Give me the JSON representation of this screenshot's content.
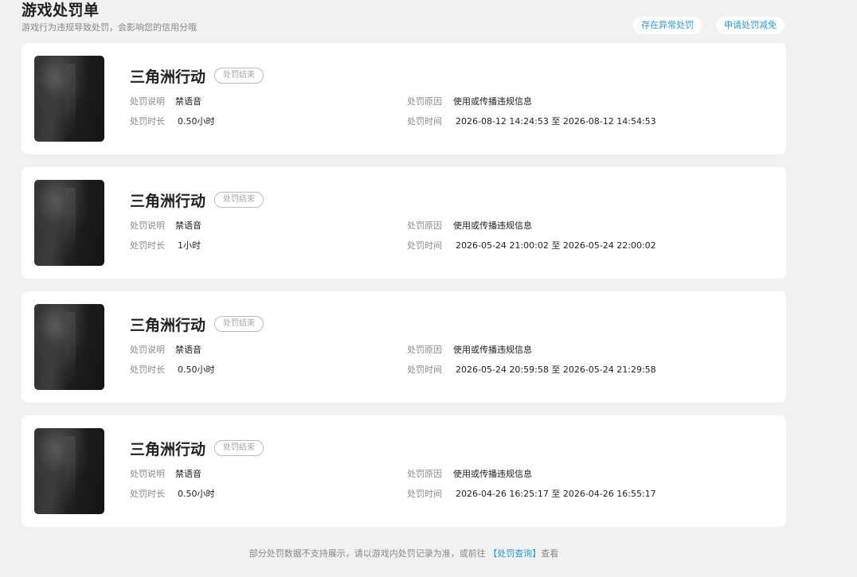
{
  "header": {
    "title": "游戏处罚单",
    "subtitle": "游戏行为违规导致处罚，会影响您的信用分哦",
    "abnormal_button": "存在异常处罚",
    "reduce_button": "申请处罚减免"
  },
  "labels": {
    "description": "处罚说明",
    "duration": "处罚时长",
    "reason": "处罚原因",
    "time": "处罚时间"
  },
  "records": [
    {
      "game": "三角洲行动",
      "status": "处罚结束",
      "description": "禁语音",
      "duration": "0.50小时",
      "reason": "使用或传播违规信息",
      "time": "2026-08-12 14:24:53 至 2026-08-12 14:54:53"
    },
    {
      "game": "三角洲行动",
      "status": "处罚结束",
      "description": "禁语音",
      "duration": "1小时",
      "reason": "使用或传播违规信息",
      "time": "2026-05-24 21:00:02 至 2026-05-24 22:00:02"
    },
    {
      "game": "三角洲行动",
      "status": "处罚结束",
      "description": "禁语音",
      "duration": "0.50小时",
      "reason": "使用或传播违规信息",
      "time": "2026-05-24 20:59:58 至 2026-05-24 21:29:58"
    },
    {
      "game": "三角洲行动",
      "status": "处罚结束",
      "description": "禁语音",
      "duration": "0.50小时",
      "reason": "使用或传播违规信息",
      "time": "2026-04-26 16:25:17 至 2026-04-26 16:55:17"
    }
  ],
  "footer": {
    "text_before": "部分处罚数据不支持展示，请以游戏内处罚记录为准，或前往",
    "link": "【处罚查询】",
    "text_after": "查看"
  },
  "colors": {
    "accent": "#1fa1d1",
    "background": "#f1f1f1"
  }
}
